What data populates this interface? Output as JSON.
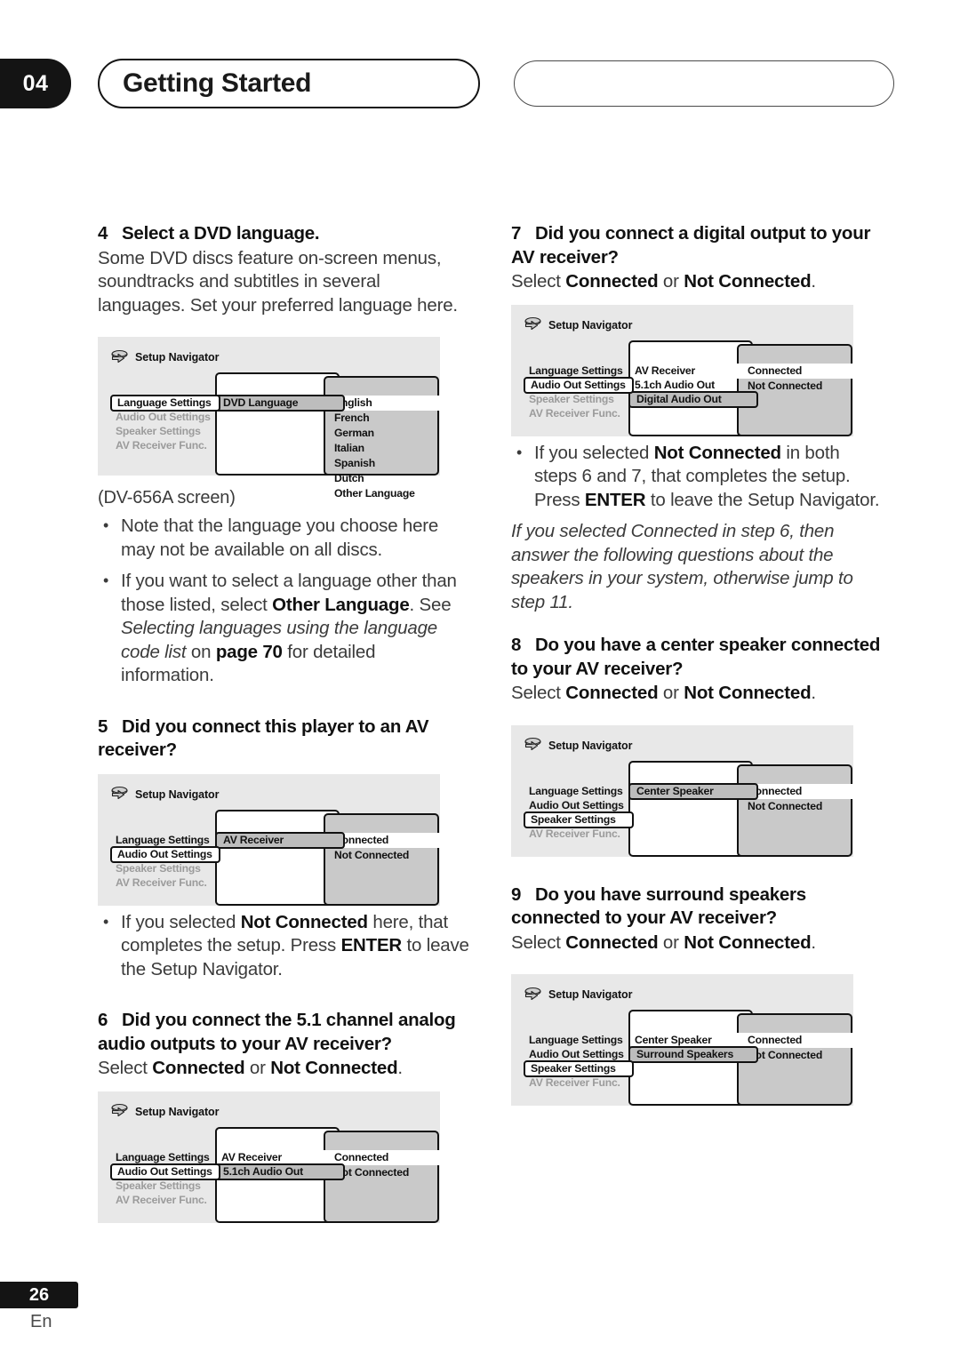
{
  "header": {
    "chapter_number": "04",
    "chapter_title": "Getting Started",
    "right_pill_label": ""
  },
  "footer": {
    "page_number": "26",
    "language_code": "En"
  },
  "icons": {
    "setup_navigator": "setup-navigator-icon"
  },
  "left_column": {
    "step4": {
      "number": "4",
      "title": "Select a DVD language.",
      "body": "Some DVD discs feature on-screen menus, soundtracks and subtitles in several languages. Set your preferred language here.",
      "screen": {
        "title": "Setup Navigator",
        "menu": [
          {
            "label": "Language Settings",
            "state": "selected"
          },
          {
            "label": "Audio Out Settings",
            "state": "dim"
          },
          {
            "label": "Speaker Settings",
            "state": "dim"
          },
          {
            "label": "AV Receiver Func.",
            "state": "dim"
          }
        ],
        "middle": [
          {
            "label": "DVD Language",
            "state": "selected"
          }
        ],
        "options": [
          {
            "label": "English",
            "state": "highlighted"
          },
          {
            "label": "French",
            "state": "normal"
          },
          {
            "label": "German",
            "state": "normal"
          },
          {
            "label": "Italian",
            "state": "normal"
          },
          {
            "label": "Spanish",
            "state": "normal"
          },
          {
            "label": "Dutch",
            "state": "normal"
          },
          {
            "label": "Other Language",
            "state": "normal"
          }
        ]
      },
      "caption": "(DV-656A screen)",
      "bullets": [
        "Note that the language you choose here may not be available on all discs.",
        "If you want to select a language other than those listed, select Other Language. See Selecting languages using the language code list on page 70 for detailed information."
      ],
      "bullet2_parts": {
        "p1": "If you want to select a language other than those listed, select ",
        "bold1": "Other Language",
        "p2": ". See ",
        "ital1": "Selecting languages using the language code list",
        "p3": " on ",
        "bold2": "page 70",
        "p4": " for detailed information."
      }
    },
    "step5": {
      "number": "5",
      "title": "Did you connect this player to an AV receiver?",
      "screen": {
        "title": "Setup Navigator",
        "menu": [
          {
            "label": "Language Settings",
            "state": "normal"
          },
          {
            "label": "Audio Out Settings",
            "state": "selected"
          },
          {
            "label": "Speaker Settings",
            "state": "dim"
          },
          {
            "label": "AV Receiver Func.",
            "state": "dim"
          }
        ],
        "middle": [
          {
            "label": "AV Receiver",
            "state": "selected"
          }
        ],
        "options": [
          {
            "label": "Connected",
            "state": "highlighted"
          },
          {
            "label": "Not Connected",
            "state": "normal"
          }
        ]
      },
      "bullet_parts": {
        "p1": "If you selected ",
        "bold1": "Not Connected",
        "p2": " here, that completes the setup. Press ",
        "bold2": "ENTER",
        "p3": " to leave the Setup Navigator."
      }
    },
    "step6": {
      "number": "6",
      "title": "Did you connect the 5.1 channel analog audio outputs to your AV receiver?",
      "instruction_parts": {
        "p1": "Select ",
        "bold1": "Connected",
        "p2": " or ",
        "bold2": "Not Connected",
        "p3": "."
      },
      "screen": {
        "title": "Setup Navigator",
        "menu": [
          {
            "label": "Language Settings",
            "state": "normal"
          },
          {
            "label": "Audio Out Settings",
            "state": "selected"
          },
          {
            "label": "Speaker Settings",
            "state": "dim"
          },
          {
            "label": "AV Receiver Func.",
            "state": "dim"
          }
        ],
        "middle": [
          {
            "label": "AV Receiver",
            "state": "plain"
          },
          {
            "label": "5.1ch Audio Out",
            "state": "selected"
          }
        ],
        "options": [
          {
            "label": "Connected",
            "state": "highlighted"
          },
          {
            "label": "Not Connected",
            "state": "normal"
          }
        ]
      }
    }
  },
  "right_column": {
    "step7": {
      "number": "7",
      "title": "Did you connect a digital output to your AV receiver?",
      "instruction_parts": {
        "p1": "Select ",
        "bold1": "Connected",
        "p2": " or ",
        "bold2": "Not Connected",
        "p3": "."
      },
      "screen": {
        "title": "Setup Navigator",
        "menu": [
          {
            "label": "Language Settings",
            "state": "normal"
          },
          {
            "label": "Audio Out Settings",
            "state": "selected"
          },
          {
            "label": "Speaker Settings",
            "state": "dim"
          },
          {
            "label": "AV Receiver Func.",
            "state": "dim"
          }
        ],
        "middle": [
          {
            "label": "AV Receiver",
            "state": "plain"
          },
          {
            "label": "5.1ch Audio Out",
            "state": "plain"
          },
          {
            "label": "Digital Audio Out",
            "state": "selected"
          }
        ],
        "options": [
          {
            "label": "Connected",
            "state": "highlighted"
          },
          {
            "label": "Not Connected",
            "state": "normal"
          }
        ]
      },
      "bullet_parts": {
        "p1": "If you selected ",
        "bold1": "Not Connected",
        "p2": " in both steps 6 and 7, that completes the setup. Press ",
        "bold2": "ENTER",
        "p3": " to leave the Setup Navigator."
      },
      "italic_note": "If you selected Connected in step 6, then answer the following questions about the speakers in your system, otherwise jump to step 11."
    },
    "step8": {
      "number": "8",
      "title": "Do you have a center speaker connected to your AV receiver?",
      "instruction_parts": {
        "p1": "Select ",
        "bold1": "Connected",
        "p2": " or ",
        "bold2": "Not Connected",
        "p3": "."
      },
      "screen": {
        "title": "Setup Navigator",
        "menu": [
          {
            "label": "Language Settings",
            "state": "normal"
          },
          {
            "label": "Audio Out Settings",
            "state": "normal"
          },
          {
            "label": "Speaker Settings",
            "state": "selected"
          },
          {
            "label": "AV Receiver Func.",
            "state": "dim"
          }
        ],
        "middle": [
          {
            "label": "Center Speaker",
            "state": "selected"
          }
        ],
        "options": [
          {
            "label": "Connected",
            "state": "highlighted"
          },
          {
            "label": "Not Connected",
            "state": "normal"
          }
        ]
      }
    },
    "step9": {
      "number": "9",
      "title": "Do you have surround speakers connected to your AV receiver?",
      "instruction_parts": {
        "p1": "Select ",
        "bold1": "Connected",
        "p2": " or ",
        "bold2": "Not Connected",
        "p3": "."
      },
      "screen": {
        "title": "Setup Navigator",
        "menu": [
          {
            "label": "Language Settings",
            "state": "normal"
          },
          {
            "label": "Audio Out Settings",
            "state": "normal"
          },
          {
            "label": "Speaker Settings",
            "state": "selected"
          },
          {
            "label": "AV Receiver Func.",
            "state": "dim"
          }
        ],
        "middle": [
          {
            "label": "Center Speaker",
            "state": "plain"
          },
          {
            "label": "Surround Speakers",
            "state": "selected"
          }
        ],
        "options": [
          {
            "label": "Connected",
            "state": "highlighted"
          },
          {
            "label": "Not Connected",
            "state": "normal"
          }
        ]
      }
    }
  }
}
